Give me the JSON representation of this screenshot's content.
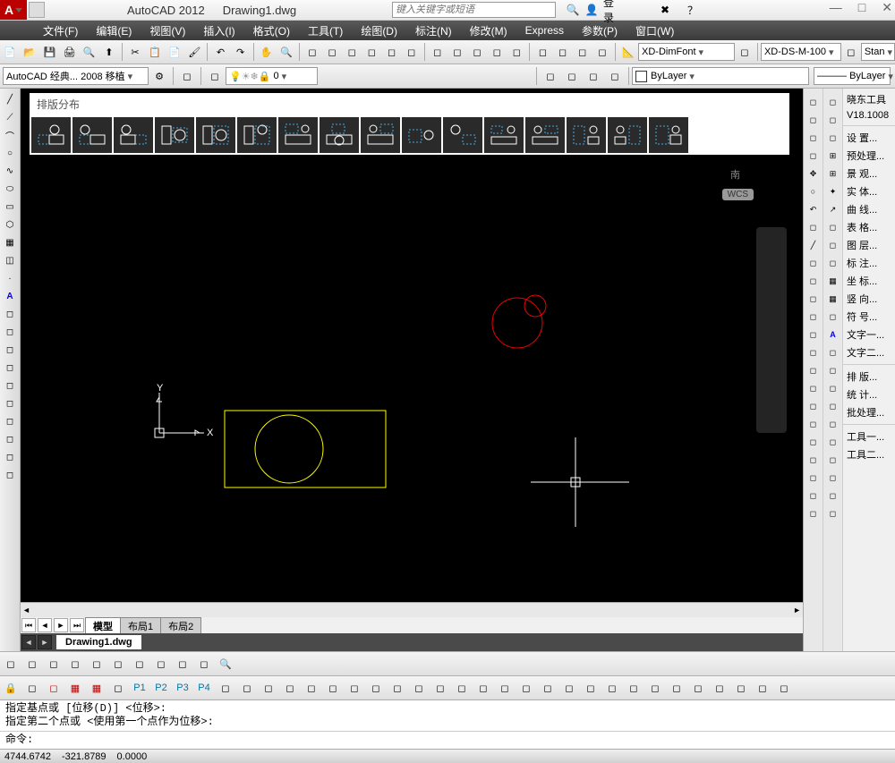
{
  "title": {
    "app": "AutoCAD 2012",
    "doc": "Drawing1.dwg"
  },
  "search_placeholder": "键入关键字或短语",
  "login": "登录",
  "menus": [
    "文件(F)",
    "编辑(E)",
    "视图(V)",
    "插入(I)",
    "格式(O)",
    "工具(T)",
    "绘图(D)",
    "标注(N)",
    "修改(M)",
    "Express",
    "参数(P)",
    "窗口(W)"
  ],
  "workspace": "AutoCAD 经典... 2008 移植",
  "layer_value": "0",
  "dimstyle": "XD-DimFont",
  "dsm": "XD-DS-M-100",
  "stan": "Stan",
  "bylayer1": "ByLayer",
  "bylayer2": "ByLayer",
  "floating_title": "排版分布",
  "wcs": "WCS",
  "compass": "南",
  "tabs": {
    "model": "模型",
    "layout1": "布局1",
    "layout2": "布局2"
  },
  "doc_tab": "Drawing1.dwg",
  "p_labels": [
    "P1",
    "P2",
    "P3",
    "P4"
  ],
  "cmd": {
    "line1": "指定基点或 [位移(D)] <位移>:",
    "line2": "指定第二个点或 <使用第一个点作为位移>:",
    "prompt": "命令:"
  },
  "status": {
    "c1": "4744.6742",
    "c2": "-321.8789",
    "c3": "0.0000"
  },
  "right_panel": {
    "title": "晓东工具",
    "version": "V18.1008",
    "items1": [
      "设    置...",
      "预处理...",
      "景    观...",
      "实    体...",
      "曲    线...",
      "表    格...",
      "图    层...",
      "标    注...",
      "坐    标...",
      "竖    向...",
      "符    号...",
      "文字一...",
      "文字二..."
    ],
    "items2": [
      "排    版...",
      "统    计...",
      "批处理..."
    ],
    "items3": [
      "工具一...",
      "工具二..."
    ]
  }
}
